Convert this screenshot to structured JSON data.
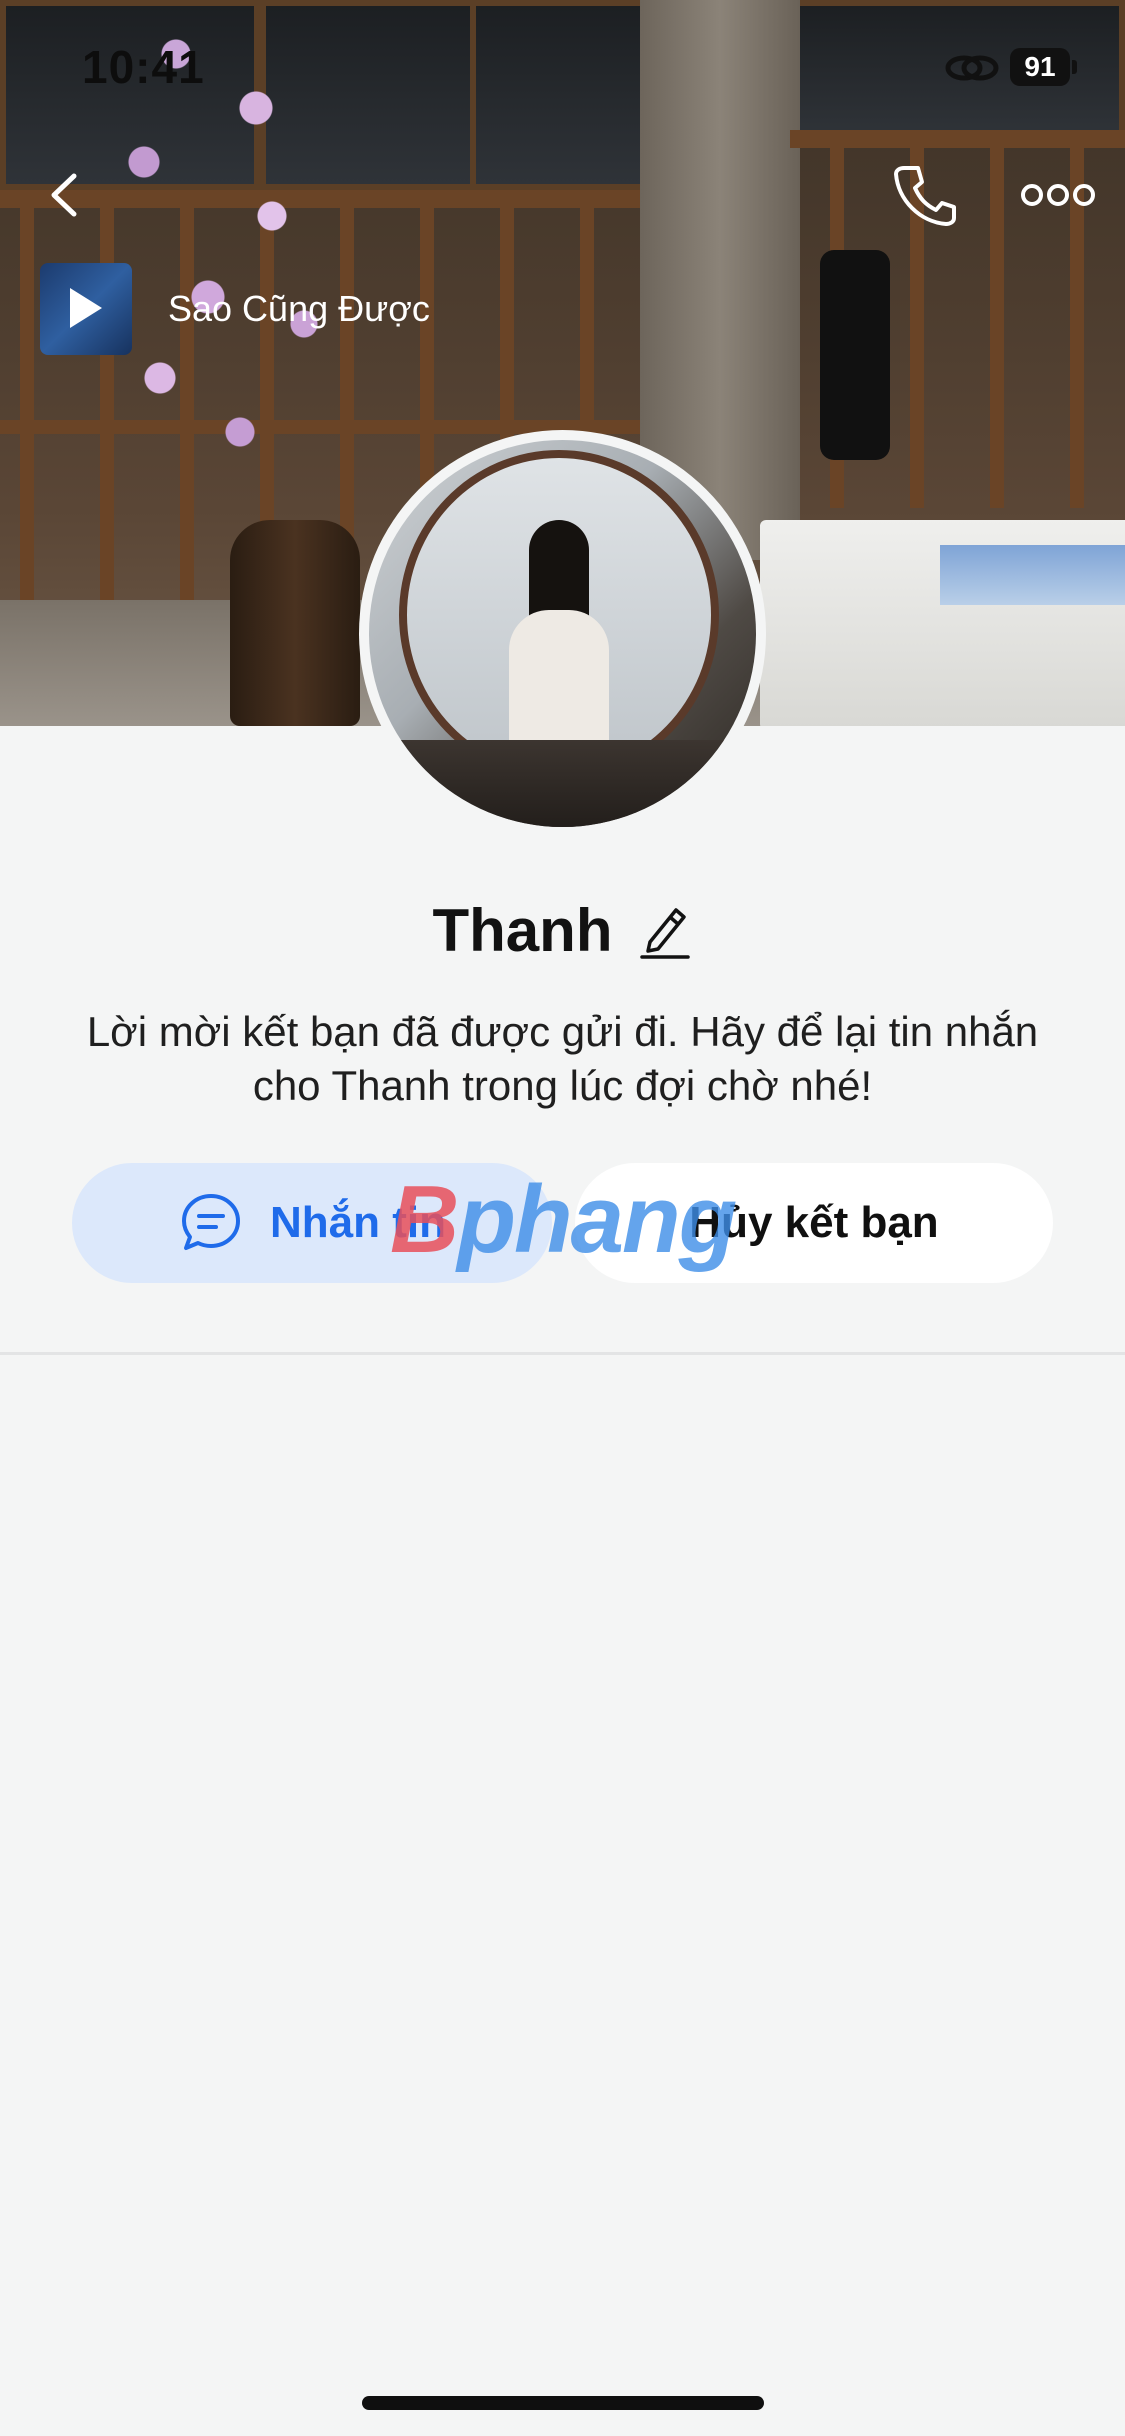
{
  "status_bar": {
    "time": "10:41",
    "battery": "91"
  },
  "music": {
    "title": "Sao Cũng Được"
  },
  "profile": {
    "name": "Thanh",
    "description": "Lời mời kết bạn đã được gửi đi. Hãy để lại tin nhắn cho Thanh trong lúc đợi chờ nhé!"
  },
  "actions": {
    "message_label": "Nhắn tin",
    "unfriend_label": "Hủy kết bạn"
  },
  "watermark": {
    "first": "B",
    "rest": "phang"
  },
  "colors": {
    "accent": "#1f6bea",
    "message_bg": "#dce8fb",
    "background": "#f4f5f5"
  },
  "icons": [
    "back-icon",
    "phone-icon",
    "more-icon",
    "play-icon",
    "edit-icon",
    "chat-icon",
    "link-icon",
    "battery-icon"
  ]
}
